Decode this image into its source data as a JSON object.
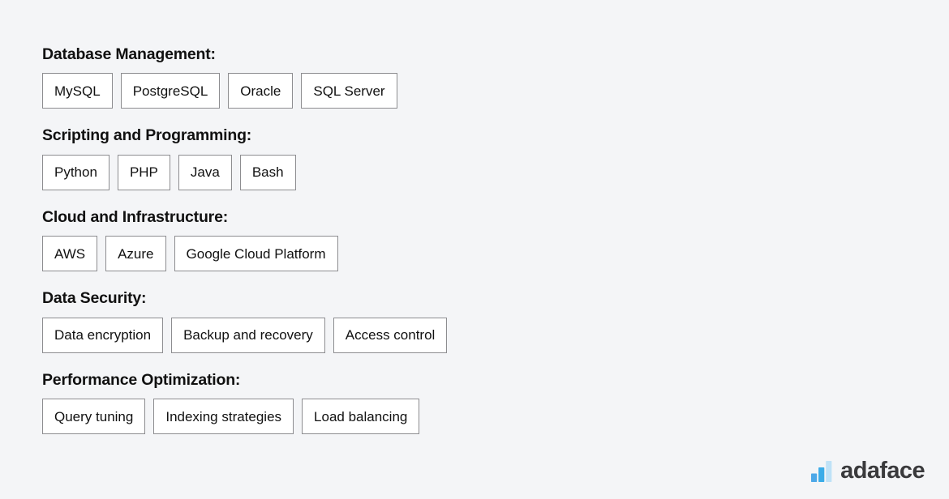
{
  "page": {
    "background_color": "#f4f5f7",
    "heading_color": "#111111",
    "chip_border_color": "#8d8d90",
    "chip_background_color": "#ffffff"
  },
  "skill_groups": [
    {
      "heading": "Database Management:",
      "chips": [
        "MySQL",
        "PostgreSQL",
        "Oracle",
        "SQL Server"
      ]
    },
    {
      "heading": "Scripting and Programming:",
      "chips": [
        "Python",
        "PHP",
        "Java",
        "Bash"
      ]
    },
    {
      "heading": "Cloud and Infrastructure:",
      "chips": [
        "AWS",
        "Azure",
        "Google Cloud Platform"
      ]
    },
    {
      "heading": "Data Security:",
      "chips": [
        "Data encryption",
        "Backup and recovery",
        "Access control"
      ]
    },
    {
      "heading": "Performance Optimization:",
      "chips": [
        "Query tuning",
        "Indexing strategies",
        "Load balancing"
      ]
    }
  ],
  "logo": {
    "wordmark": "adaface",
    "icon_name": "bar-chart-logo-mark",
    "wordmark_color": "#3a3a3c",
    "bar_colors": [
      "#4da8e8",
      "#3bace8",
      "#bfe2f7"
    ]
  }
}
